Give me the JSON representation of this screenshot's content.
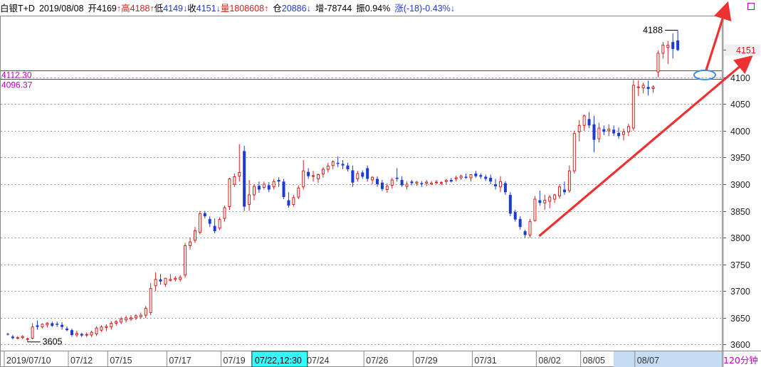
{
  "header": {
    "instrument": "白银T+D",
    "date": "2019/08/08",
    "open_label": "开",
    "open_value": "4169",
    "open_arrow": "↑",
    "high_label": "高",
    "high_value": "4188",
    "high_arrow": "↑",
    "low_label": "低",
    "low_value": "4149",
    "low_arrow": "↓",
    "close_label": "收",
    "close_value": "4151",
    "close_arrow": "↓",
    "volume_label": "量",
    "volume_value": "1808608",
    "volume_arrow": "↑",
    "oi_label": "仓",
    "oi_value": "20886",
    "oi_arrow": "↓",
    "oi_change_label": "增",
    "oi_change_value": "-78744",
    "amplitude_label": "振",
    "amplitude_value": "0.94%",
    "change_label": "涨",
    "change_value": "(-18)-0.43%",
    "change_arrow": "↓"
  },
  "colors": {
    "up": "#d81e1e",
    "down": "#1c3ad6",
    "grid": "#9a9a9a",
    "level_lines": "#c000c0",
    "annotation_arrow": "#ee3232",
    "ellipse": "#3a8ee6",
    "timeframe_label": "#c000c0"
  },
  "chart_data": {
    "type": "candlestick",
    "ylim": [
      3590,
      4210
    ],
    "y_ticks": [
      3600,
      3650,
      3700,
      3750,
      3800,
      3850,
      3900,
      3950,
      4000,
      4050,
      4100
    ],
    "x_tick_labels": [
      "2019/07/10",
      "07/12",
      "07/15",
      "07/17",
      "07/19",
      "07/24",
      "07/26",
      "07/29",
      "07/31",
      "08/02",
      "08/05",
      "08/07"
    ],
    "x_tick_bar_index": [
      0,
      13,
      21,
      33,
      44,
      61,
      73,
      83,
      95,
      108,
      117,
      128
    ],
    "crosshair_label": "07/22,12:30",
    "crosshair_bar_index": 52,
    "timeframe": "120分钟",
    "last_price": "4151",
    "level_lines": [
      {
        "value": 4112.3,
        "label": "4112.30"
      },
      {
        "value": 4096.37,
        "label": "4096.37"
      }
    ],
    "annotations": [
      {
        "label": "4188",
        "value": 4188
      },
      {
        "label": "3605",
        "value": 3605
      }
    ],
    "candles": [
      [
        3620,
        3622,
        3617,
        3619
      ],
      [
        3615,
        3618,
        3610,
        3612
      ],
      [
        3612,
        3616,
        3610,
        3613
      ],
      [
        3613,
        3618,
        3610,
        3615
      ],
      [
        3610,
        3613,
        3605,
        3611
      ],
      [
        3612,
        3640,
        3610,
        3633
      ],
      [
        3636,
        3645,
        3628,
        3633
      ],
      [
        3633,
        3640,
        3630,
        3638
      ],
      [
        3637,
        3642,
        3632,
        3640
      ],
      [
        3640,
        3643,
        3633,
        3635
      ],
      [
        3639,
        3643,
        3633,
        3637
      ],
      [
        3637,
        3642,
        3628,
        3633
      ],
      [
        3630,
        3634,
        3625,
        3627
      ],
      [
        3627,
        3630,
        3615,
        3618
      ],
      [
        3618,
        3626,
        3614,
        3621
      ],
      [
        3620,
        3622,
        3614,
        3617
      ],
      [
        3618,
        3623,
        3614,
        3619
      ],
      [
        3618,
        3626,
        3614,
        3623
      ],
      [
        3620,
        3634,
        3616,
        3631
      ],
      [
        3627,
        3636,
        3624,
        3633
      ],
      [
        3632,
        3638,
        3625,
        3634
      ],
      [
        3633,
        3644,
        3628,
        3640
      ],
      [
        3640,
        3646,
        3635,
        3643
      ],
      [
        3642,
        3652,
        3638,
        3648
      ],
      [
        3646,
        3654,
        3641,
        3650
      ],
      [
        3648,
        3655,
        3644,
        3650
      ],
      [
        3650,
        3657,
        3646,
        3654
      ],
      [
        3652,
        3660,
        3648,
        3655
      ],
      [
        3655,
        3672,
        3650,
        3668
      ],
      [
        3660,
        3715,
        3655,
        3705
      ],
      [
        3710,
        3735,
        3700,
        3722
      ],
      [
        3722,
        3732,
        3712,
        3718
      ],
      [
        3713,
        3725,
        3708,
        3724
      ],
      [
        3720,
        3732,
        3718,
        3722
      ],
      [
        3722,
        3728,
        3718,
        3724
      ],
      [
        3722,
        3730,
        3718,
        3726
      ],
      [
        3730,
        3790,
        3725,
        3785
      ],
      [
        3785,
        3800,
        3778,
        3792
      ],
      [
        3795,
        3820,
        3790,
        3813
      ],
      [
        3810,
        3850,
        3806,
        3845
      ],
      [
        3846,
        3850,
        3836,
        3840
      ],
      [
        3835,
        3840,
        3820,
        3826
      ],
      [
        3822,
        3836,
        3808,
        3812
      ],
      [
        3818,
        3838,
        3814,
        3834
      ],
      [
        3836,
        3860,
        3830,
        3856
      ],
      [
        3858,
        3912,
        3852,
        3910
      ],
      [
        3900,
        3920,
        3895,
        3914
      ],
      [
        3915,
        3975,
        3905,
        3922
      ],
      [
        3962,
        3972,
        3850,
        3858
      ],
      [
        3862,
        3908,
        3850,
        3880
      ],
      [
        3880,
        3900,
        3870,
        3896
      ],
      [
        3897,
        3905,
        3884,
        3890
      ],
      [
        3894,
        3905,
        3890,
        3900
      ],
      [
        3898,
        3904,
        3885,
        3890
      ],
      [
        3895,
        3910,
        3890,
        3905
      ],
      [
        3908,
        3913,
        3895,
        3905
      ],
      [
        3905,
        3910,
        3872,
        3876
      ],
      [
        3870,
        3885,
        3856,
        3860
      ],
      [
        3862,
        3880,
        3858,
        3875
      ],
      [
        3876,
        3898,
        3872,
        3893
      ],
      [
        3895,
        3945,
        3890,
        3925
      ],
      [
        3923,
        3930,
        3910,
        3915
      ],
      [
        3915,
        3925,
        3905,
        3916
      ],
      [
        3910,
        3920,
        3902,
        3918
      ],
      [
        3919,
        3932,
        3912,
        3928
      ],
      [
        3928,
        3940,
        3922,
        3934
      ],
      [
        3935,
        3945,
        3928,
        3942
      ],
      [
        3940,
        3952,
        3932,
        3938
      ],
      [
        3938,
        3945,
        3928,
        3935
      ],
      [
        3935,
        3940,
        3924,
        3928
      ],
      [
        3926,
        3935,
        3895,
        3903
      ],
      [
        3910,
        3925,
        3905,
        3920
      ],
      [
        3922,
        3926,
        3910,
        3914
      ],
      [
        3930,
        3935,
        3905,
        3910
      ],
      [
        3908,
        3915,
        3900,
        3913
      ],
      [
        3910,
        3915,
        3895,
        3900
      ],
      [
        3903,
        3908,
        3887,
        3891
      ],
      [
        3890,
        3902,
        3884,
        3896
      ],
      [
        3898,
        3912,
        3892,
        3908
      ],
      [
        3912,
        3930,
        3905,
        3910
      ],
      [
        3908,
        3915,
        3895,
        3898
      ],
      [
        3896,
        3905,
        3890,
        3900
      ],
      [
        3905,
        3908,
        3898,
        3902
      ],
      [
        3902,
        3906,
        3897,
        3904
      ],
      [
        3902,
        3906,
        3895,
        3900
      ],
      [
        3902,
        3908,
        3896,
        3904
      ],
      [
        3900,
        3906,
        3898,
        3902
      ],
      [
        3904,
        3908,
        3900,
        3904
      ],
      [
        3902,
        3906,
        3898,
        3903
      ],
      [
        3905,
        3910,
        3900,
        3907
      ],
      [
        3908,
        3912,
        3903,
        3905
      ],
      [
        3910,
        3916,
        3905,
        3912
      ],
      [
        3912,
        3918,
        3908,
        3915
      ],
      [
        3914,
        3920,
        3910,
        3912
      ],
      [
        3912,
        3918,
        3905,
        3918
      ],
      [
        3920,
        3925,
        3912,
        3915
      ],
      [
        3917,
        3920,
        3910,
        3914
      ],
      [
        3914,
        3918,
        3906,
        3910
      ],
      [
        3912,
        3918,
        3900,
        3905
      ],
      [
        3900,
        3910,
        3890,
        3896
      ],
      [
        3895,
        3915,
        3885,
        3905
      ],
      [
        3902,
        3906,
        3880,
        3885
      ],
      [
        3880,
        3885,
        3840,
        3845
      ],
      [
        3848,
        3852,
        3830,
        3834
      ],
      [
        3835,
        3840,
        3815,
        3820
      ],
      [
        3812,
        3815,
        3800,
        3805
      ],
      [
        3805,
        3835,
        3800,
        3830
      ],
      [
        3832,
        3878,
        3830,
        3872
      ],
      [
        3870,
        3888,
        3860,
        3865
      ],
      [
        3865,
        3880,
        3852,
        3870
      ],
      [
        3868,
        3880,
        3855,
        3876
      ],
      [
        3872,
        3882,
        3865,
        3880
      ],
      [
        3878,
        3900,
        3873,
        3895
      ],
      [
        3890,
        3905,
        3880,
        3885
      ],
      [
        3888,
        3935,
        3884,
        3925
      ],
      [
        3925,
        4000,
        3920,
        3995
      ],
      [
        3998,
        4020,
        3980,
        4010
      ],
      [
        4010,
        4030,
        4000,
        4028
      ],
      [
        4022,
        4035,
        4005,
        4010
      ],
      [
        4012,
        4028,
        3960,
        3983
      ],
      [
        3985,
        4015,
        3978,
        4005
      ],
      [
        4003,
        4010,
        3992,
        3998
      ],
      [
        4000,
        4012,
        3990,
        4003
      ],
      [
        4002,
        4010,
        3990,
        3995
      ],
      [
        3996,
        4006,
        3985,
        3990
      ],
      [
        3993,
        4004,
        3982,
        3998
      ],
      [
        3998,
        4013,
        3990,
        4008
      ],
      [
        4005,
        4095,
        4000,
        4085
      ],
      [
        4082,
        4094,
        4065,
        4082
      ],
      [
        4080,
        4090,
        4070,
        4085
      ],
      [
        4082,
        4094,
        4066,
        4078
      ],
      [
        4079,
        4085,
        4071,
        4082
      ],
      [
        4110,
        4150,
        4100,
        4145
      ],
      [
        4145,
        4166,
        4135,
        4160
      ],
      [
        4156,
        4168,
        4125,
        4160
      ],
      [
        4166,
        4182,
        4135,
        4153
      ],
      [
        4169,
        4188,
        4149,
        4151
      ]
    ]
  }
}
